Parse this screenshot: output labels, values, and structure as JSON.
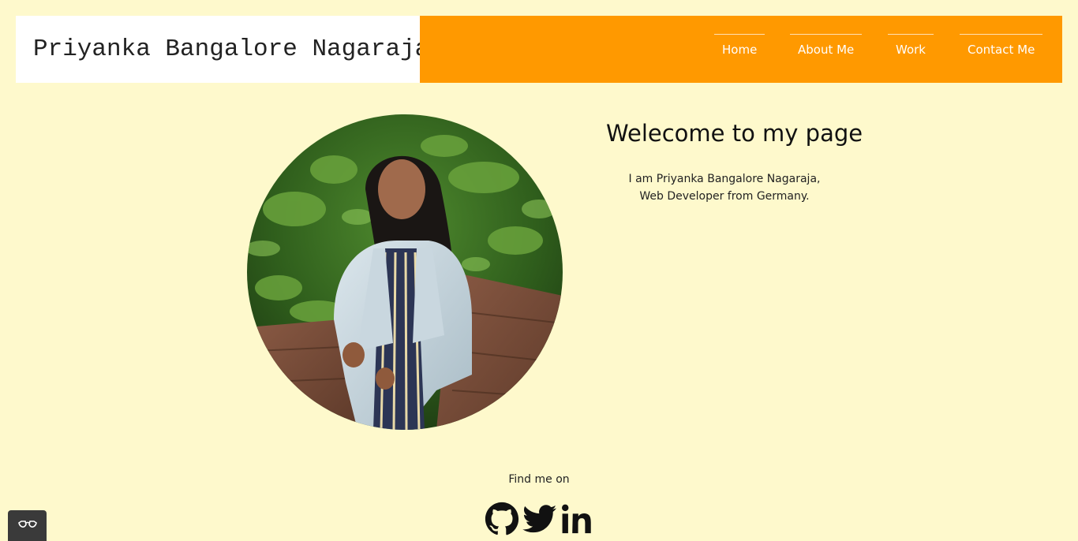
{
  "header": {
    "brand_name": "Priyanka Bangalore Nagaraja"
  },
  "nav": {
    "items": [
      {
        "label": "Home"
      },
      {
        "label": "About Me"
      },
      {
        "label": "Work"
      },
      {
        "label": "Contact Me"
      }
    ]
  },
  "main": {
    "heading": "Welecome to my page",
    "intro": "I am Priyanka Bangalore Nagaraja, Web Developer from Germany."
  },
  "footer": {
    "find_me_label": "Find me on",
    "social_icons": [
      "github-icon",
      "twitter-icon",
      "linkedin-icon"
    ]
  },
  "widget": {
    "icon": "glasses-icon"
  },
  "colors": {
    "background": "#fef9cc",
    "nav_background": "#ff9900",
    "brand_background": "#ffffff"
  }
}
